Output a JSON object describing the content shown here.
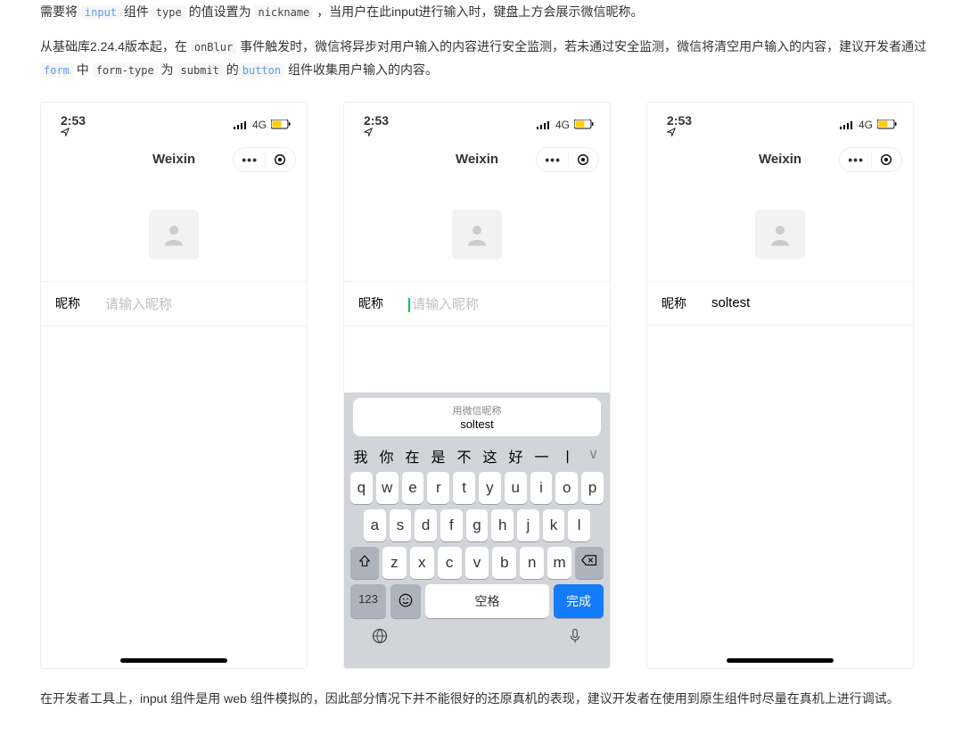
{
  "text": {
    "p1_a": "需要将 ",
    "p1_b": " 组件 ",
    "p1_c": " 的值设置为 ",
    "p1_d": " ，当用户在此input进行输入时，键盘上方会展示微信昵称。",
    "p2_a": "从基础库2.24.4版本起，在 ",
    "p2_b": " 事件触发时，微信将异步对用户输入的内容进行安全监测，若未通过安全监测，微信将清空用户输入的内容，建议开发者通过 ",
    "p2_c": " 中 ",
    "p2_d": " 为 ",
    "p2_e": " 的",
    "p2_f": " 组件收集用户输入的内容。",
    "p3": "在开发者工具上，input 组件是用 web 组件模拟的，因此部分情况下并不能很好的还原真机的表现，建议开发者在使用到原生组件时尽量在真机上进行调试。"
  },
  "code": {
    "input": "input",
    "type": "type",
    "nickname": "nickname",
    "onBlur": "onBlur",
    "form": "form",
    "formType": "form-type",
    "submit": "submit",
    "button": "button"
  },
  "phone": {
    "time": "2:53",
    "signal": "4G",
    "title": "Weixin",
    "label": "昵称",
    "placeholder": "请输入昵称",
    "value": "soltest"
  },
  "keyboard": {
    "suggest_title": "用微信昵称",
    "suggest_name": "soltest",
    "candidates": [
      "我",
      "你",
      "在",
      "是",
      "不",
      "这",
      "好",
      "一",
      "ㅣ",
      "∨"
    ],
    "row1": [
      "q",
      "w",
      "e",
      "r",
      "t",
      "y",
      "u",
      "i",
      "o",
      "p"
    ],
    "row2": [
      "a",
      "s",
      "d",
      "f",
      "g",
      "h",
      "j",
      "k",
      "l"
    ],
    "row3": [
      "z",
      "x",
      "c",
      "v",
      "b",
      "n",
      "m"
    ],
    "num": "123",
    "space": "空格",
    "done": "完成"
  }
}
